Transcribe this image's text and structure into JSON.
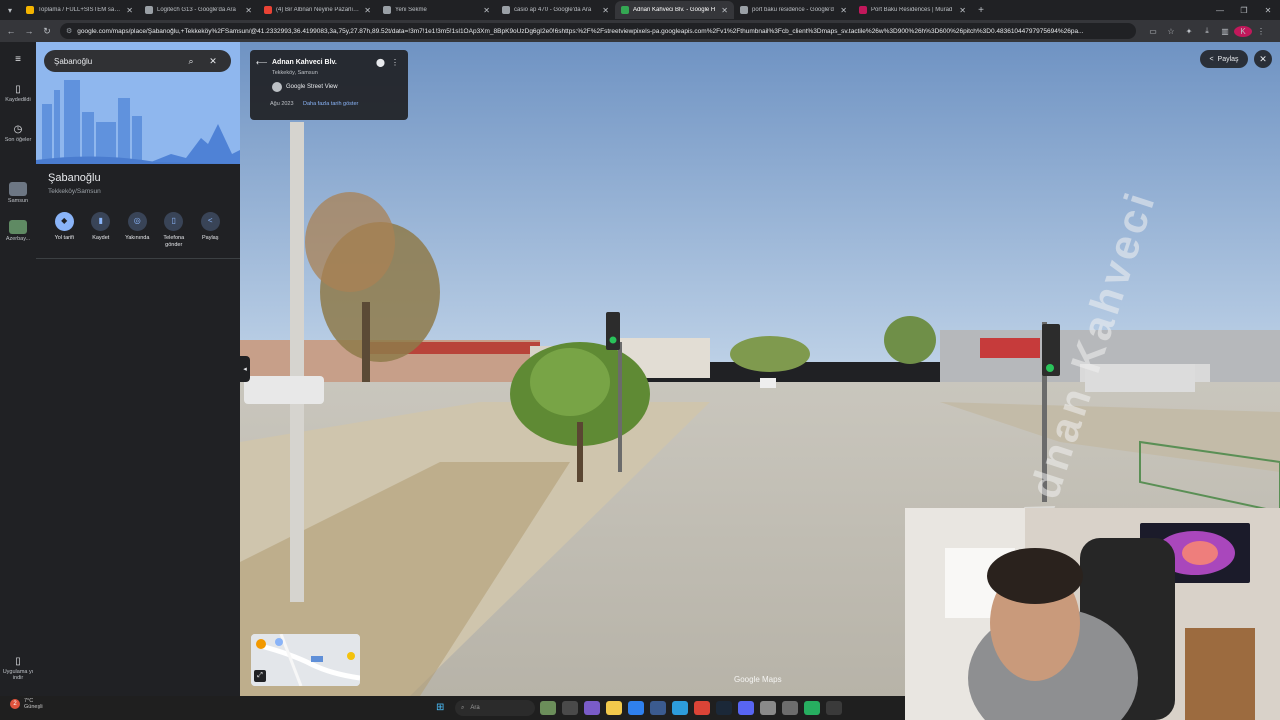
{
  "browser": {
    "tabs": [
      {
        "label": "Toplama / FULL+SİSTEM sahibi",
        "color": "#f4b400",
        "active": false
      },
      {
        "label": "Logitech G13 - Google'da Ara",
        "color": "#9aa0a6",
        "active": false
      },
      {
        "label": "(4) Bir Albnan Neyine Pazarlık Y",
        "color": "#ea4335",
        "active": false
      },
      {
        "label": "Yeni Sekme",
        "color": "#9aa0a6",
        "active": false
      },
      {
        "label": "casio ap 470 - Google'da Ara",
        "color": "#9aa0a6",
        "active": false
      },
      {
        "label": "Adnan Kahveci Blv. - Google H",
        "color": "#34a853",
        "active": true
      },
      {
        "label": "port baku residence - Google'd",
        "color": "#9aa0a6",
        "active": false
      },
      {
        "label": "Port Baku Residences | Murad",
        "color": "#c2185b",
        "active": false
      }
    ],
    "url": "google.com/maps/place/Şabanoğlu,+Tekkeköy%2FSamsun/@41.2332993,36.4199083,3a,75y,27.87h,89.52t/data=!3m7!1e1!3m5!1sl1OAp3Xm_8BpK9oUzDg6gI2e0!6shttps:%2F%2Fstreetviewpixels-pa.googleapis.com%2Fv1%2Fthumbnail%3Fcb_client%3Dmaps_sv.tactile%26w%3D900%26h%3D600%26pitch%3D0.48361044797975694%26pa...",
    "profile_initial": "K"
  },
  "rail": {
    "saved": "Kaydedildi",
    "recent": "Son öğeler",
    "recent_1": "Samsun",
    "recent_2": "Azerbay...",
    "get_app": "Uygulama yı indir"
  },
  "place": {
    "search_value": "Şabanoğlu",
    "name": "Şabanoğlu",
    "subtitle": "Tekkeköy/Samsun",
    "actions": [
      {
        "label": "Yol tarifi",
        "icon": "directions-icon",
        "glyph": "◆"
      },
      {
        "label": "Kaydet",
        "icon": "bookmark-icon",
        "glyph": "▮"
      },
      {
        "label": "Yakınında",
        "icon": "nearby-icon",
        "glyph": "◎"
      },
      {
        "label": "Telefona gönder",
        "icon": "phone-icon",
        "glyph": "▯"
      },
      {
        "label": "Paylaş",
        "icon": "share-icon",
        "glyph": "<"
      }
    ]
  },
  "streetview": {
    "road": "Adnan Kahveci Blv.",
    "location": "Tekkeköy, Samsun",
    "source": "Google Street View",
    "date": "Ağu 2023",
    "more_dates_link": "Daha fazla tarih göster",
    "share_label": "Paylaş",
    "road_marking": "Adnan Kahveci",
    "logo": "Google Maps"
  },
  "taskbar": {
    "weather_temp": "7°C",
    "weather_desc": "Güneşli",
    "weather_badge": "2",
    "search_placeholder": "Ara"
  }
}
